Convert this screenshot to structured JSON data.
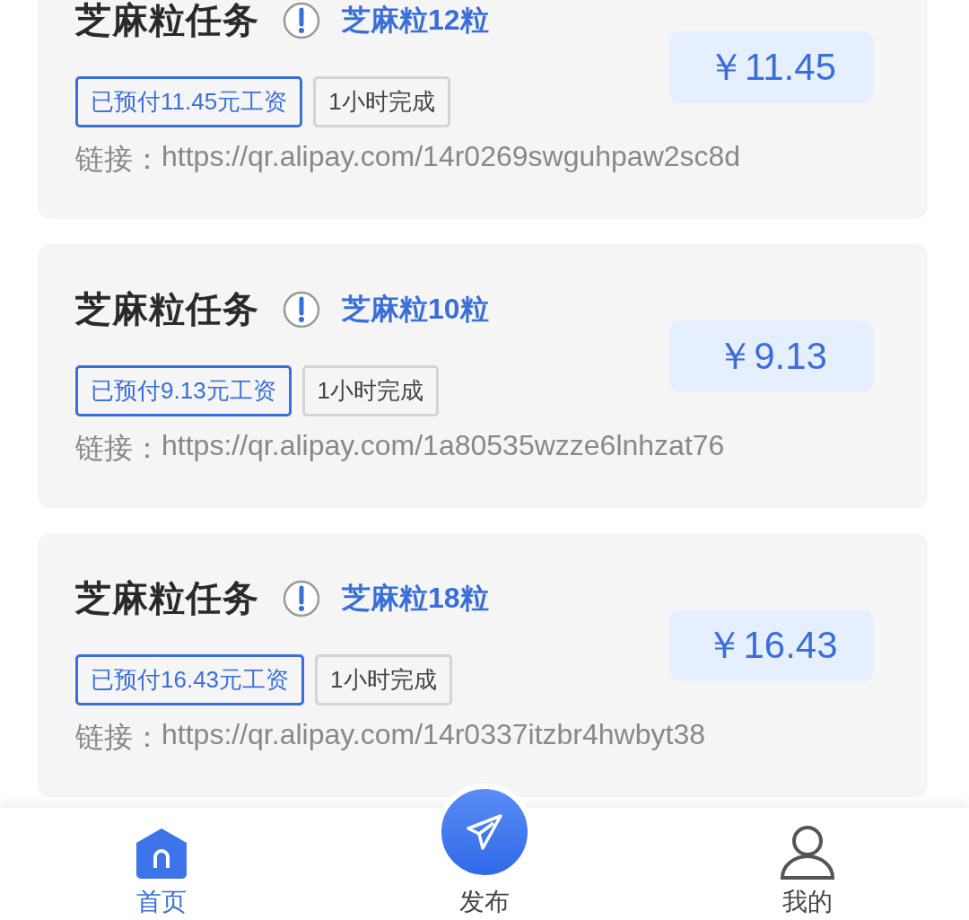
{
  "tasks": [
    {
      "title": "芝麻粒任务",
      "reward": "芝麻粒12粒",
      "tags": [
        {
          "kind": "paid",
          "text": "已预付11.45元工资"
        },
        {
          "kind": "time",
          "text": "1小时完成"
        }
      ],
      "link_label": "链接：",
      "link": "https://qr.alipay.com/14r0269swguhpaw2sc8d",
      "price": "￥11.45"
    },
    {
      "title": "芝麻粒任务",
      "reward": "芝麻粒10粒",
      "tags": [
        {
          "kind": "paid",
          "text": "已预付9.13元工资"
        },
        {
          "kind": "time",
          "text": "1小时完成"
        }
      ],
      "link_label": "链接：",
      "link": "https://qr.alipay.com/1a80535wzze6lnhzat76",
      "price": "￥9.13"
    },
    {
      "title": "芝麻粒任务",
      "reward": "芝麻粒18粒",
      "tags": [
        {
          "kind": "paid",
          "text": "已预付16.43元工资"
        },
        {
          "kind": "time",
          "text": "1小时完成"
        }
      ],
      "link_label": "链接：",
      "link": "https://qr.alipay.com/14r0337itzbr4hwbyt38",
      "price": "￥16.43"
    }
  ],
  "tab_bar": [
    {
      "kind": "home",
      "label": "首页",
      "selected": true
    },
    {
      "kind": "publish",
      "label": "发布",
      "selected": false
    },
    {
      "kind": "profile",
      "label": "我的",
      "selected": false
    }
  ]
}
